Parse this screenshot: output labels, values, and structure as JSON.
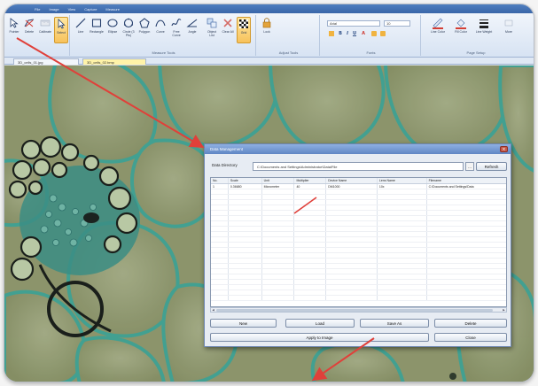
{
  "menubar": {
    "items": [
      "File",
      "Image",
      "View",
      "Capture",
      "Measure"
    ]
  },
  "ribbon": {
    "groups": [
      {
        "label": ""
      },
      {
        "label": "Measure Tools"
      },
      {
        "label": "Adjust Tools"
      },
      {
        "label": "Fonts"
      },
      {
        "label": "Page Setup"
      }
    ],
    "tools": [
      {
        "name": "pointer-tool",
        "label": "Pointer"
      },
      {
        "name": "delete-tool",
        "label": "Delete"
      },
      {
        "name": "calibrate-tool",
        "label": "Calibrate"
      },
      {
        "name": "select-tool",
        "label": "Select"
      },
      {
        "name": "line-tool",
        "label": "Line"
      },
      {
        "name": "rectangle-tool",
        "label": "Rectangle"
      },
      {
        "name": "ellipse-tool",
        "label": "Ellipse"
      },
      {
        "name": "circle-tool",
        "label": "Circle (3 Pts)"
      },
      {
        "name": "polygon-tool",
        "label": "Polygon"
      },
      {
        "name": "curve-tool",
        "label": "Curve"
      },
      {
        "name": "freehand-tool",
        "label": "Free Curve"
      },
      {
        "name": "angle-tool",
        "label": "Angle"
      },
      {
        "name": "objects-tool",
        "label": "Object List"
      },
      {
        "name": "clear-tool",
        "label": "Clear All"
      },
      {
        "name": "grid-tool",
        "label": "Grid"
      },
      {
        "name": "lock-tool",
        "label": "Lock"
      }
    ],
    "font_name": "Arial",
    "font_size": "10",
    "page_setup": [
      {
        "name": "line-color",
        "label": "Line Color"
      },
      {
        "name": "fill-color",
        "label": "Fill Color"
      },
      {
        "name": "line-weight",
        "label": "Line Weight"
      },
      {
        "name": "more",
        "label": "More"
      }
    ]
  },
  "tabs": [
    {
      "label": "3D_cells_01.jpg"
    },
    {
      "label": "3D_cells_02.bmp"
    }
  ],
  "dialog": {
    "title": "Data Management",
    "dir_label": "Data Directory",
    "dir_value": "C:\\Documents and Settings\\Administrator\\Data\\File",
    "browse_label": "...",
    "refresh_label": "Refresh",
    "columns": [
      "No.",
      "Scale",
      "Unit",
      "Multiplier",
      "Device Name",
      "Lens Name",
      "Filename"
    ],
    "rows": [
      [
        "1",
        "0.36680",
        "Micrometer",
        "40",
        "DM1000",
        "10x",
        "C:\\Documents and Settings\\Data"
      ]
    ],
    "empty_rows": 21,
    "buttons": {
      "new": "New",
      "load": "Load",
      "save_as": "Save As",
      "delete": "Delete",
      "apply": "Apply to Image",
      "close": "Close"
    }
  },
  "colors": {
    "ribbon_top": "#f1f5fb",
    "active_tool": "#f7c25b",
    "arrow": "#e0403a",
    "stain_green": "#3a9c8e",
    "cell_bg": "#8b9469"
  }
}
